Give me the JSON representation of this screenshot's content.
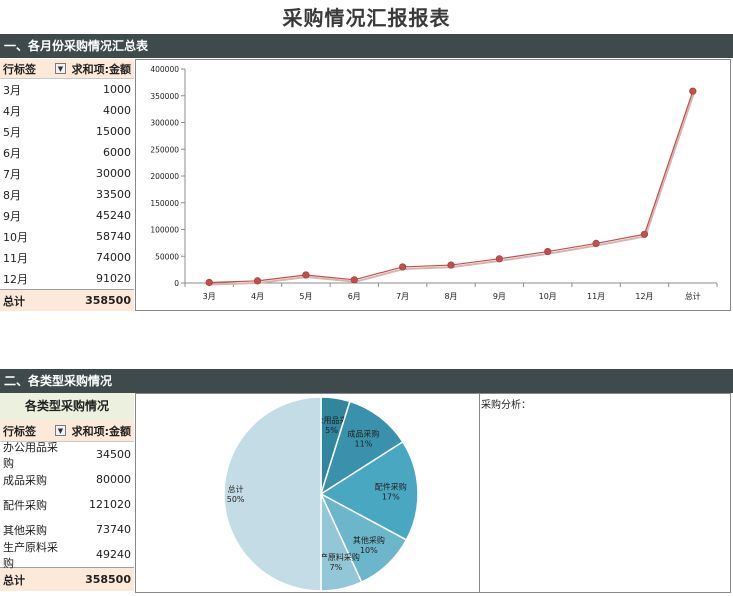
{
  "title": "采购情况汇报报表",
  "section1": {
    "heading": "一、各月份采购情况汇总表"
  },
  "section2": {
    "heading": "二、各类型采购情况",
    "table_title": "各类型采购情况"
  },
  "pivot1": {
    "col1": "行标签",
    "col2": "求和项:金额",
    "rows": [
      {
        "k": "3月",
        "v": "1000"
      },
      {
        "k": "4月",
        "v": "4000"
      },
      {
        "k": "5月",
        "v": "15000"
      },
      {
        "k": "6月",
        "v": "6000"
      },
      {
        "k": "7月",
        "v": "30000"
      },
      {
        "k": "8月",
        "v": "33500"
      },
      {
        "k": "9月",
        "v": "45240"
      },
      {
        "k": "10月",
        "v": "58740"
      },
      {
        "k": "11月",
        "v": "74000"
      },
      {
        "k": "12月",
        "v": "91020"
      }
    ],
    "total_label": "总计",
    "total_value": "358500"
  },
  "pivot2": {
    "col1": "行标签",
    "col2": "求和项:金额",
    "rows": [
      {
        "k": "办公用品采购",
        "v": "34500"
      },
      {
        "k": "成品采购",
        "v": "80000"
      },
      {
        "k": "配件采购",
        "v": "121020"
      },
      {
        "k": "其他采购",
        "v": "73740"
      },
      {
        "k": "生产原料采购",
        "v": "49240"
      }
    ],
    "total_label": "总计",
    "total_value": "358500"
  },
  "analysis_label": "采购分析：",
  "chart_data": [
    {
      "type": "line",
      "categories": [
        "3月",
        "4月",
        "5月",
        "6月",
        "7月",
        "8月",
        "9月",
        "10月",
        "11月",
        "12月",
        "总计"
      ],
      "values": [
        1000,
        4000,
        15000,
        6000,
        30000,
        33500,
        45240,
        58740,
        74000,
        91020,
        358500
      ],
      "yticks": [
        0,
        50000,
        100000,
        150000,
        200000,
        250000,
        300000,
        350000,
        400000
      ],
      "ylim": [
        0,
        400000
      ],
      "color": "#c0504d",
      "grid": false,
      "legend": "none"
    },
    {
      "type": "pie",
      "slices": [
        {
          "label": "办公用品采购",
          "value": 34500,
          "pct": "5%",
          "color": "#31859c"
        },
        {
          "label": "成品采购",
          "value": 80000,
          "pct": "11%",
          "color": "#3a91ab"
        },
        {
          "label": "配件采购",
          "value": 121020,
          "pct": "17%",
          "color": "#4aa7c1"
        },
        {
          "label": "其他采购",
          "value": 73740,
          "pct": "10%",
          "color": "#6cb6cc"
        },
        {
          "label": "生产原料采购",
          "value": 49240,
          "pct": "7%",
          "color": "#93c6d6"
        },
        {
          "label": "总计",
          "value": 358500,
          "pct": "50%",
          "color": "#c4dce5"
        }
      ],
      "legend": "none"
    }
  ]
}
